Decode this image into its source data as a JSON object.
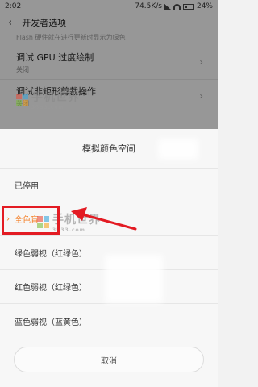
{
  "status_bar": {
    "time": "2:02",
    "speed": "74.5K/s",
    "battery": "24%"
  },
  "header": {
    "title": "开发者选项"
  },
  "settings": {
    "note": "Flash 硬件就在进行更新时显示为绿色",
    "items": [
      {
        "title": "调试 GPU 过度绘制",
        "subtitle": "关闭"
      },
      {
        "title": "调试非矩形剪裁操作",
        "subtitle": "关闭"
      }
    ]
  },
  "dialog": {
    "title": "模拟颜色空间",
    "options": [
      {
        "label": "已停用",
        "selected": false
      },
      {
        "label": "全色盲",
        "selected": true
      },
      {
        "label": "绿色弱视（红绿色）",
        "selected": false
      },
      {
        "label": "红色弱视（红绿色）",
        "selected": false
      },
      {
        "label": "蓝色弱视（蓝黄色）",
        "selected": false
      }
    ],
    "cancel_label": "取消",
    "selected_marker": "›"
  },
  "watermark": {
    "text": "手机世界",
    "site": "3533.com"
  },
  "colors": {
    "accent": "#f47b20",
    "highlight": "#e31b23"
  }
}
